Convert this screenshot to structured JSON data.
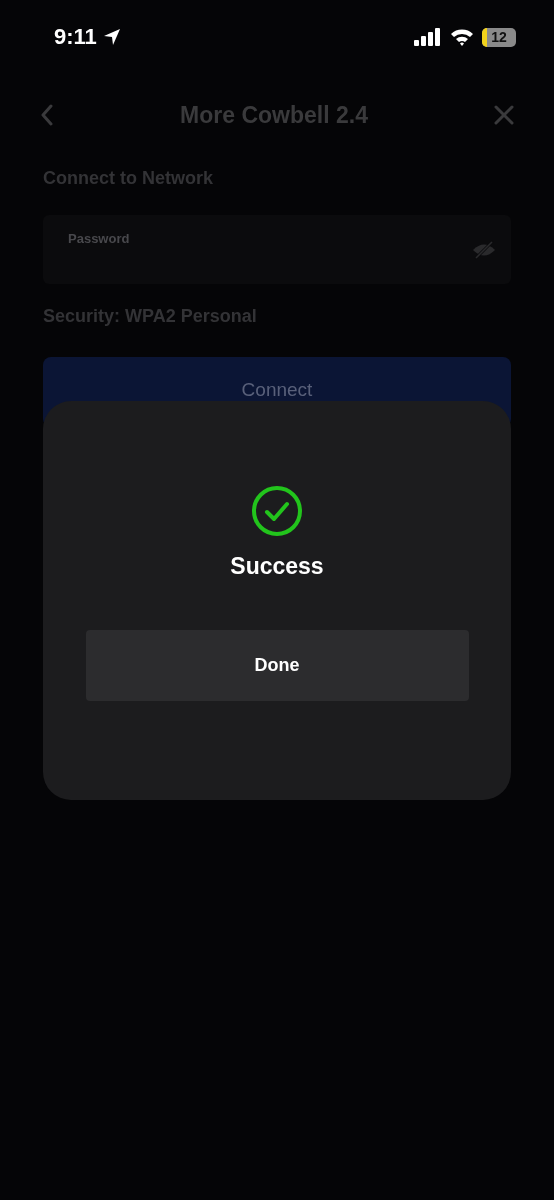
{
  "status_bar": {
    "time": "9:11",
    "battery": "12"
  },
  "nav": {
    "title": "More Cowbell 2.4"
  },
  "heading": "Connect to Network",
  "password_field": {
    "placeholder": "Password"
  },
  "security": "Security: WPA2 Personal",
  "connect_button": "Connect",
  "dialog": {
    "kind": "success",
    "title": "Success",
    "button": "Done"
  }
}
